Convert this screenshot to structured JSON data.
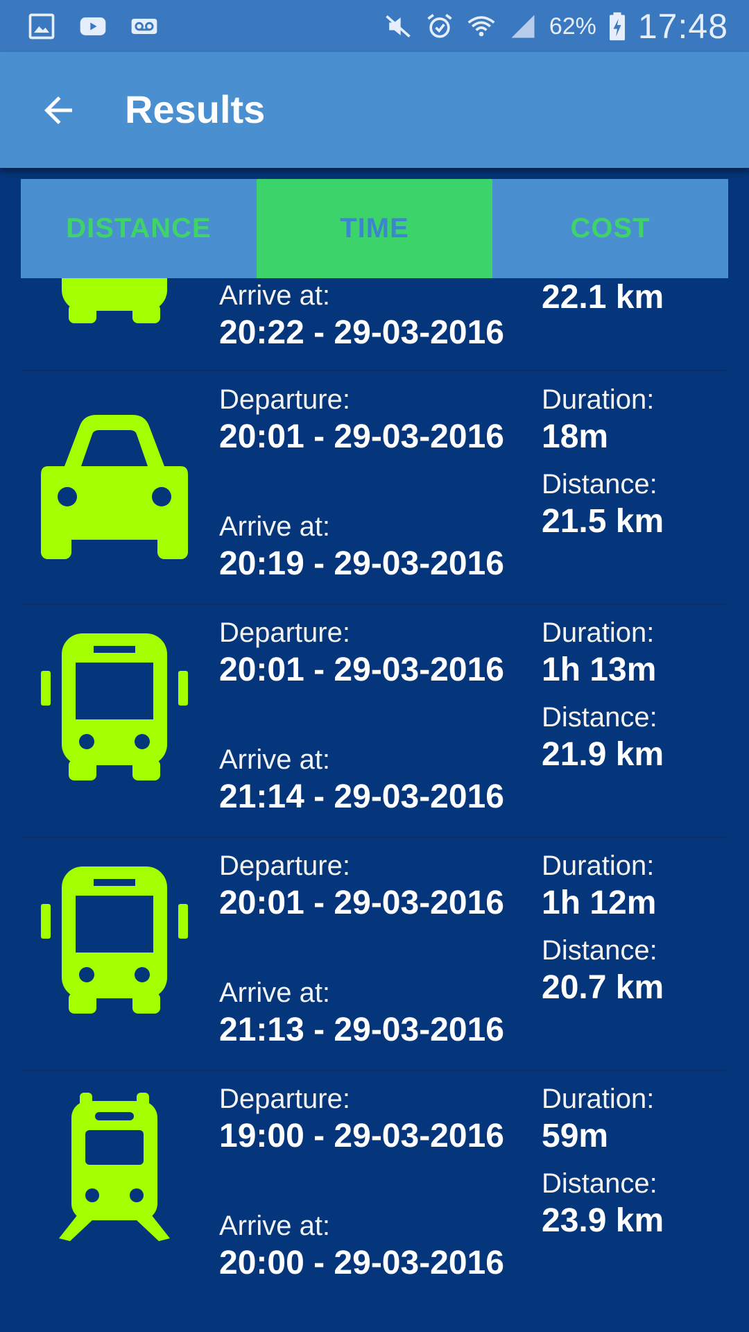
{
  "status_bar": {
    "left_icons": [
      "gallery-icon",
      "youtube-icon",
      "voicemail-icon"
    ],
    "right_icons": [
      "mute-icon",
      "alarm-icon",
      "wifi-icon",
      "signal-icon",
      "battery-charging-icon"
    ],
    "battery": "62%",
    "time": "17:48"
  },
  "app_bar": {
    "back_icon": "arrow-left-icon",
    "title": "Results"
  },
  "tabs": [
    {
      "label": "DISTANCE",
      "active": false
    },
    {
      "label": "TIME",
      "active": true
    },
    {
      "label": "COST",
      "active": false
    }
  ],
  "results": [
    {
      "vehicle": "bus-icon",
      "arrive_label": "Arrive at:",
      "arrive_value": "20:22 - 29-03-2016",
      "distance_value": "22.1 km"
    },
    {
      "vehicle": "car-icon",
      "departure_label": "Departure:",
      "departure_value": "20:01 - 29-03-2016",
      "arrive_label": "Arrive at:",
      "arrive_value": "20:19 - 29-03-2016",
      "duration_label": "Duration:",
      "duration_value": "18m",
      "distance_label": "Distance:",
      "distance_value": "21.5 km"
    },
    {
      "vehicle": "bus-icon",
      "departure_label": "Departure:",
      "departure_value": "20:01 - 29-03-2016",
      "arrive_label": "Arrive at:",
      "arrive_value": "21:14 - 29-03-2016",
      "duration_label": "Duration:",
      "duration_value": "1h 13m",
      "distance_label": "Distance:",
      "distance_value": "21.9 km"
    },
    {
      "vehicle": "bus-icon",
      "departure_label": "Departure:",
      "departure_value": "20:01 - 29-03-2016",
      "arrive_label": "Arrive at:",
      "arrive_value": "21:13 - 29-03-2016",
      "duration_label": "Duration:",
      "duration_value": "1h 12m",
      "distance_label": "Distance:",
      "distance_value": "20.7 km"
    },
    {
      "vehicle": "train-icon",
      "departure_label": "Departure:",
      "departure_value": "19:00 - 29-03-2016",
      "arrive_label": "Arrive at:",
      "arrive_value": "20:00 - 29-03-2016",
      "duration_label": "Duration:",
      "duration_value": "59m",
      "distance_label": "Distance:",
      "distance_value": "23.9 km"
    }
  ],
  "colors": {
    "background": "#05357a",
    "app_bar": "#4a8fd0",
    "tab_active": "#3dd36b",
    "tab_text": "#3fd36a",
    "vehicle_icon": "#a4ff00"
  }
}
